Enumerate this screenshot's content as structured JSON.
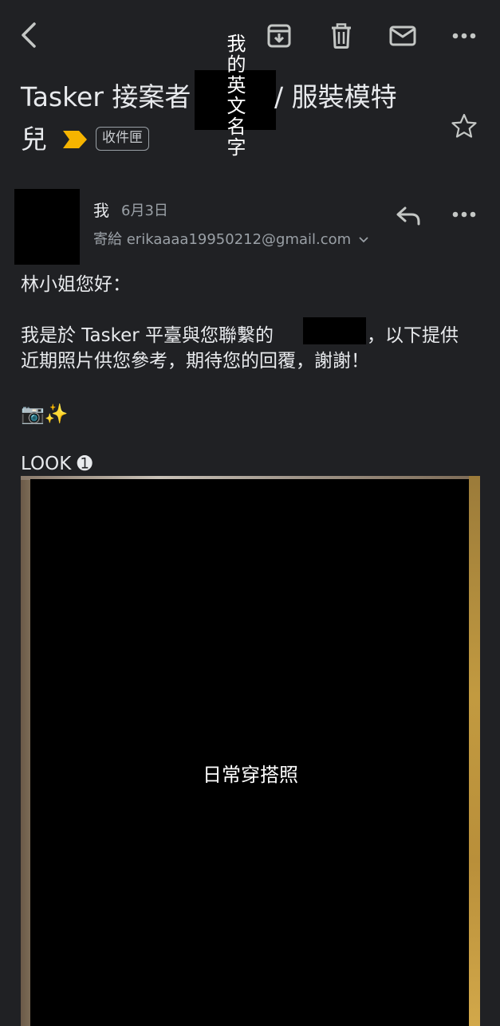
{
  "toolbar": {
    "back": "back-icon",
    "archive": "archive-icon",
    "delete": "trash-icon",
    "mark_unread": "mail-icon",
    "more": "more-icon"
  },
  "subject": {
    "line1_prefix": "Tasker 接案者",
    "line1_suffix": "/ 服裝模特",
    "line2": "兒",
    "label": "收件匣",
    "redaction_note": "我的英文名字"
  },
  "message": {
    "sender": "我",
    "date": "6月3日",
    "recipient_prefix": "寄給",
    "recipient_email": "erikaaaa19950212@gmail.com",
    "greeting": "林小姐您好：",
    "para1_line1_a": "我是於 Tasker 平臺與您聯繫的",
    "para1_line1_b": "，以下提供",
    "para1_line2": "近期照片供您參考，期待您的回覆，謝謝！",
    "emoji_line": "📷✨",
    "look_title": "LOOK ➊",
    "photo_caption": "日常穿搭照"
  }
}
